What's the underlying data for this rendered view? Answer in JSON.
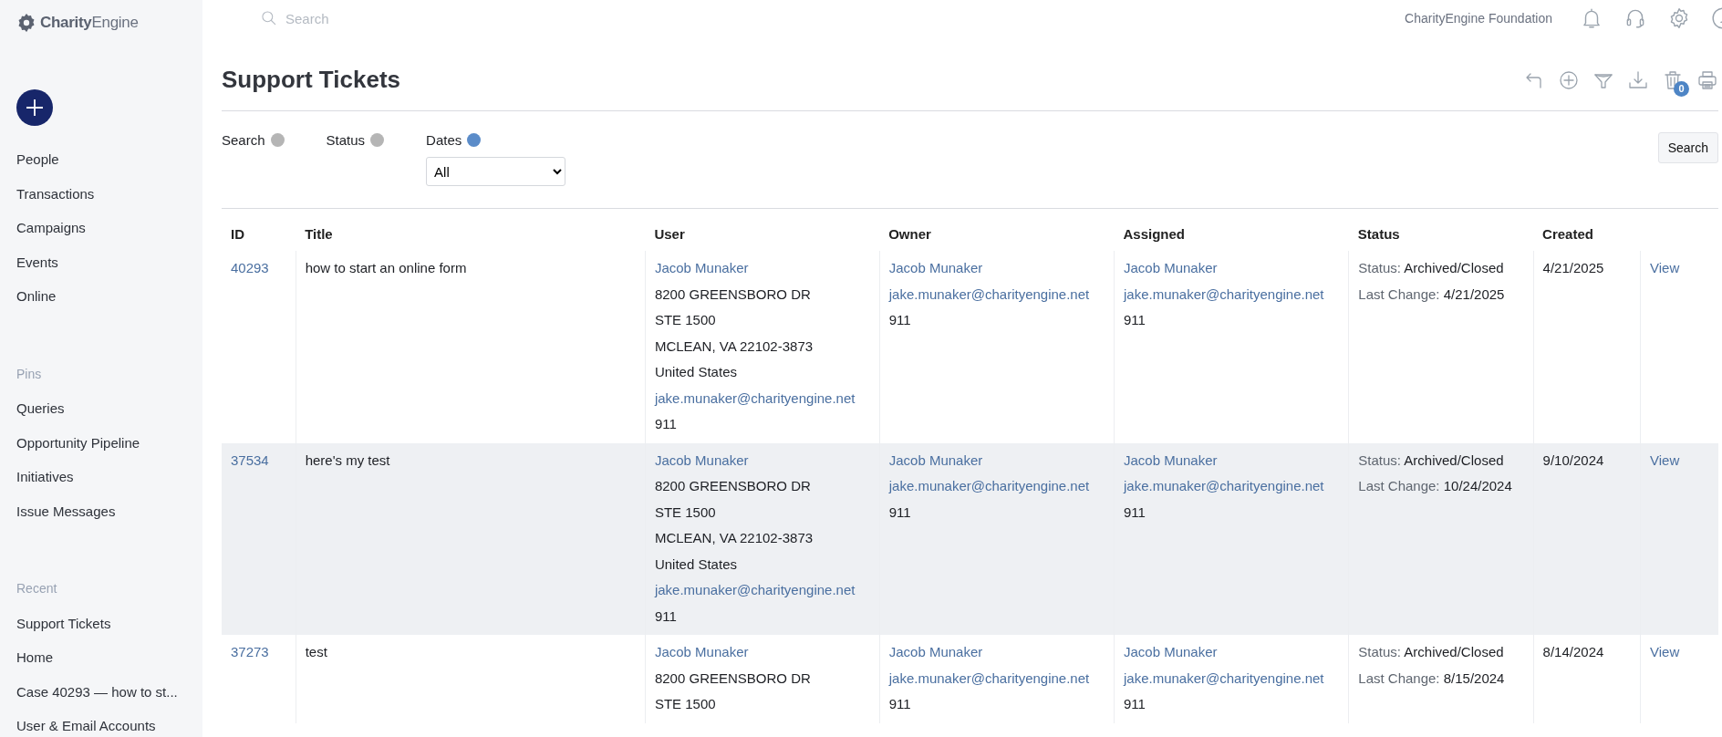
{
  "sidebar": {
    "logo": {
      "bold": "Charity",
      "light": "Engine"
    },
    "nav": [
      {
        "label": "People"
      },
      {
        "label": "Transactions"
      },
      {
        "label": "Campaigns"
      },
      {
        "label": "Events"
      },
      {
        "label": "Online"
      }
    ],
    "sections": [
      {
        "heading": "Pins",
        "items": [
          {
            "label": "Queries"
          },
          {
            "label": "Opportunity Pipeline"
          },
          {
            "label": "Initiatives"
          },
          {
            "label": "Issue Messages"
          }
        ]
      },
      {
        "heading": "Recent",
        "items": [
          {
            "label": "Support Tickets"
          },
          {
            "label": "Home"
          },
          {
            "label": "Case 40293 — how to st..."
          },
          {
            "label": "User & Email Accounts"
          }
        ]
      }
    ]
  },
  "topbar": {
    "search_placeholder": "Search",
    "organization": "CharityEngine Foundation"
  },
  "page": {
    "title": "Support Tickets",
    "trash_count": "0"
  },
  "filters": [
    {
      "label": "Search",
      "color": "#b5b5b5"
    },
    {
      "label": "Status",
      "color": "#b5b5b5"
    },
    {
      "label": "Dates",
      "color": "#5b8cc9",
      "select": "All"
    }
  ],
  "search_button": "Search",
  "table": {
    "columns": [
      "ID",
      "Title",
      "User",
      "Owner",
      "Assigned",
      "Status",
      "Created",
      ""
    ],
    "rows": [
      {
        "id": "40293",
        "title": "how to start an online form",
        "highlighted": false,
        "user": [
          {
            "kind": "link",
            "text": "Jacob Munaker"
          },
          {
            "kind": "text",
            "text": "8200 GREENSBORO DR"
          },
          {
            "kind": "text",
            "text": "STE 1500"
          },
          {
            "kind": "text",
            "text": "MCLEAN, VA 22102-3873"
          },
          {
            "kind": "text",
            "text": "United States"
          },
          {
            "kind": "link",
            "text": "jake.munaker@charityengine.net"
          },
          {
            "kind": "text",
            "text": "911"
          }
        ],
        "owner": [
          {
            "kind": "link",
            "text": "Jacob Munaker"
          },
          {
            "kind": "link",
            "text": "jake.munaker@charityengine.net"
          },
          {
            "kind": "text",
            "text": "911"
          }
        ],
        "assigned": [
          {
            "kind": "link",
            "text": "Jacob Munaker"
          },
          {
            "kind": "link",
            "text": "jake.munaker@charityengine.net"
          },
          {
            "kind": "text",
            "text": "911"
          }
        ],
        "status": [
          {
            "label": "Status:",
            "value": "Archived/Closed"
          },
          {
            "label": "Last Change:",
            "value": "4/21/2025"
          }
        ],
        "created": "4/21/2025",
        "action": "View"
      },
      {
        "id": "37534",
        "title": "here's my test",
        "highlighted": true,
        "user": [
          {
            "kind": "link",
            "text": "Jacob Munaker"
          },
          {
            "kind": "text",
            "text": "8200 GREENSBORO DR"
          },
          {
            "kind": "text",
            "text": "STE 1500"
          },
          {
            "kind": "text",
            "text": "MCLEAN, VA 22102-3873"
          },
          {
            "kind": "text",
            "text": "United States"
          },
          {
            "kind": "link",
            "text": "jake.munaker@charityengine.net"
          },
          {
            "kind": "text",
            "text": "911"
          }
        ],
        "owner": [
          {
            "kind": "link",
            "text": "Jacob Munaker"
          },
          {
            "kind": "link",
            "text": "jake.munaker@charityengine.net"
          },
          {
            "kind": "text",
            "text": "911"
          }
        ],
        "assigned": [
          {
            "kind": "link",
            "text": "Jacob Munaker"
          },
          {
            "kind": "link",
            "text": "jake.munaker@charityengine.net"
          },
          {
            "kind": "text",
            "text": "911"
          }
        ],
        "status": [
          {
            "label": "Status:",
            "value": "Archived/Closed"
          },
          {
            "label": "Last Change:",
            "value": "10/24/2024"
          }
        ],
        "created": "9/10/2024",
        "action": "View"
      },
      {
        "id": "37273",
        "title": "test",
        "highlighted": false,
        "user": [
          {
            "kind": "link",
            "text": "Jacob Munaker"
          },
          {
            "kind": "text",
            "text": "8200 GREENSBORO DR"
          },
          {
            "kind": "text",
            "text": "STE 1500"
          }
        ],
        "owner": [
          {
            "kind": "link",
            "text": "Jacob Munaker"
          },
          {
            "kind": "link",
            "text": "jake.munaker@charityengine.net"
          },
          {
            "kind": "text",
            "text": "911"
          }
        ],
        "assigned": [
          {
            "kind": "link",
            "text": "Jacob Munaker"
          },
          {
            "kind": "link",
            "text": "jake.munaker@charityengine.net"
          },
          {
            "kind": "text",
            "text": "911"
          }
        ],
        "status": [
          {
            "label": "Status:",
            "value": "Archived/Closed"
          },
          {
            "label": "Last Change:",
            "value": "8/15/2024"
          }
        ],
        "created": "8/14/2024",
        "action": "View"
      }
    ]
  }
}
